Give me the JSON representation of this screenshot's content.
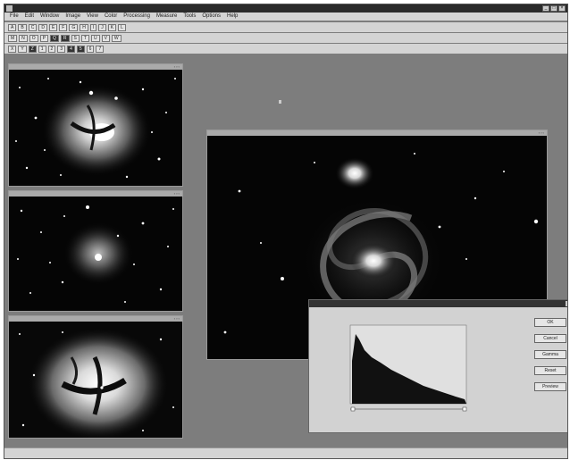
{
  "app": {
    "title": "",
    "menus": [
      "File",
      "Edit",
      "Window",
      "Image",
      "View",
      "Color",
      "Processing",
      "Measure",
      "Tools",
      "Options",
      "Help"
    ]
  },
  "toolbars": [
    [
      "A",
      "B",
      "C",
      "D",
      "E",
      "F",
      "G",
      "H",
      "I",
      "J",
      "K",
      "L"
    ],
    [
      "M",
      "N",
      "O",
      "P",
      "Q",
      "R",
      "S",
      "T",
      "U",
      "V",
      "W"
    ],
    [
      "X",
      "Y",
      "Z",
      "1",
      "2",
      "3",
      "4",
      "5",
      "6",
      "7"
    ]
  ],
  "windows": {
    "nebula_1": "",
    "nebula_2": "",
    "nebula_3": "",
    "galaxy": ""
  },
  "histogram_dialog": {
    "title": "",
    "buttons": [
      "OK",
      "Cancel",
      "Gamma",
      "Reset",
      "Preview"
    ],
    "stats": [
      "",
      "",
      "",
      "",
      "",
      "",
      "",
      "",
      "",
      ""
    ],
    "y_label": "",
    "x_label": "",
    "x_min": "",
    "x_max": "",
    "y_ticks": [
      "",
      "",
      ""
    ]
  },
  "status": {
    "text": ""
  },
  "colors": {
    "app_bg": "#7d7d7d",
    "chrome": "#d4d4d4",
    "dialog_bg": "#d2d2d2"
  }
}
